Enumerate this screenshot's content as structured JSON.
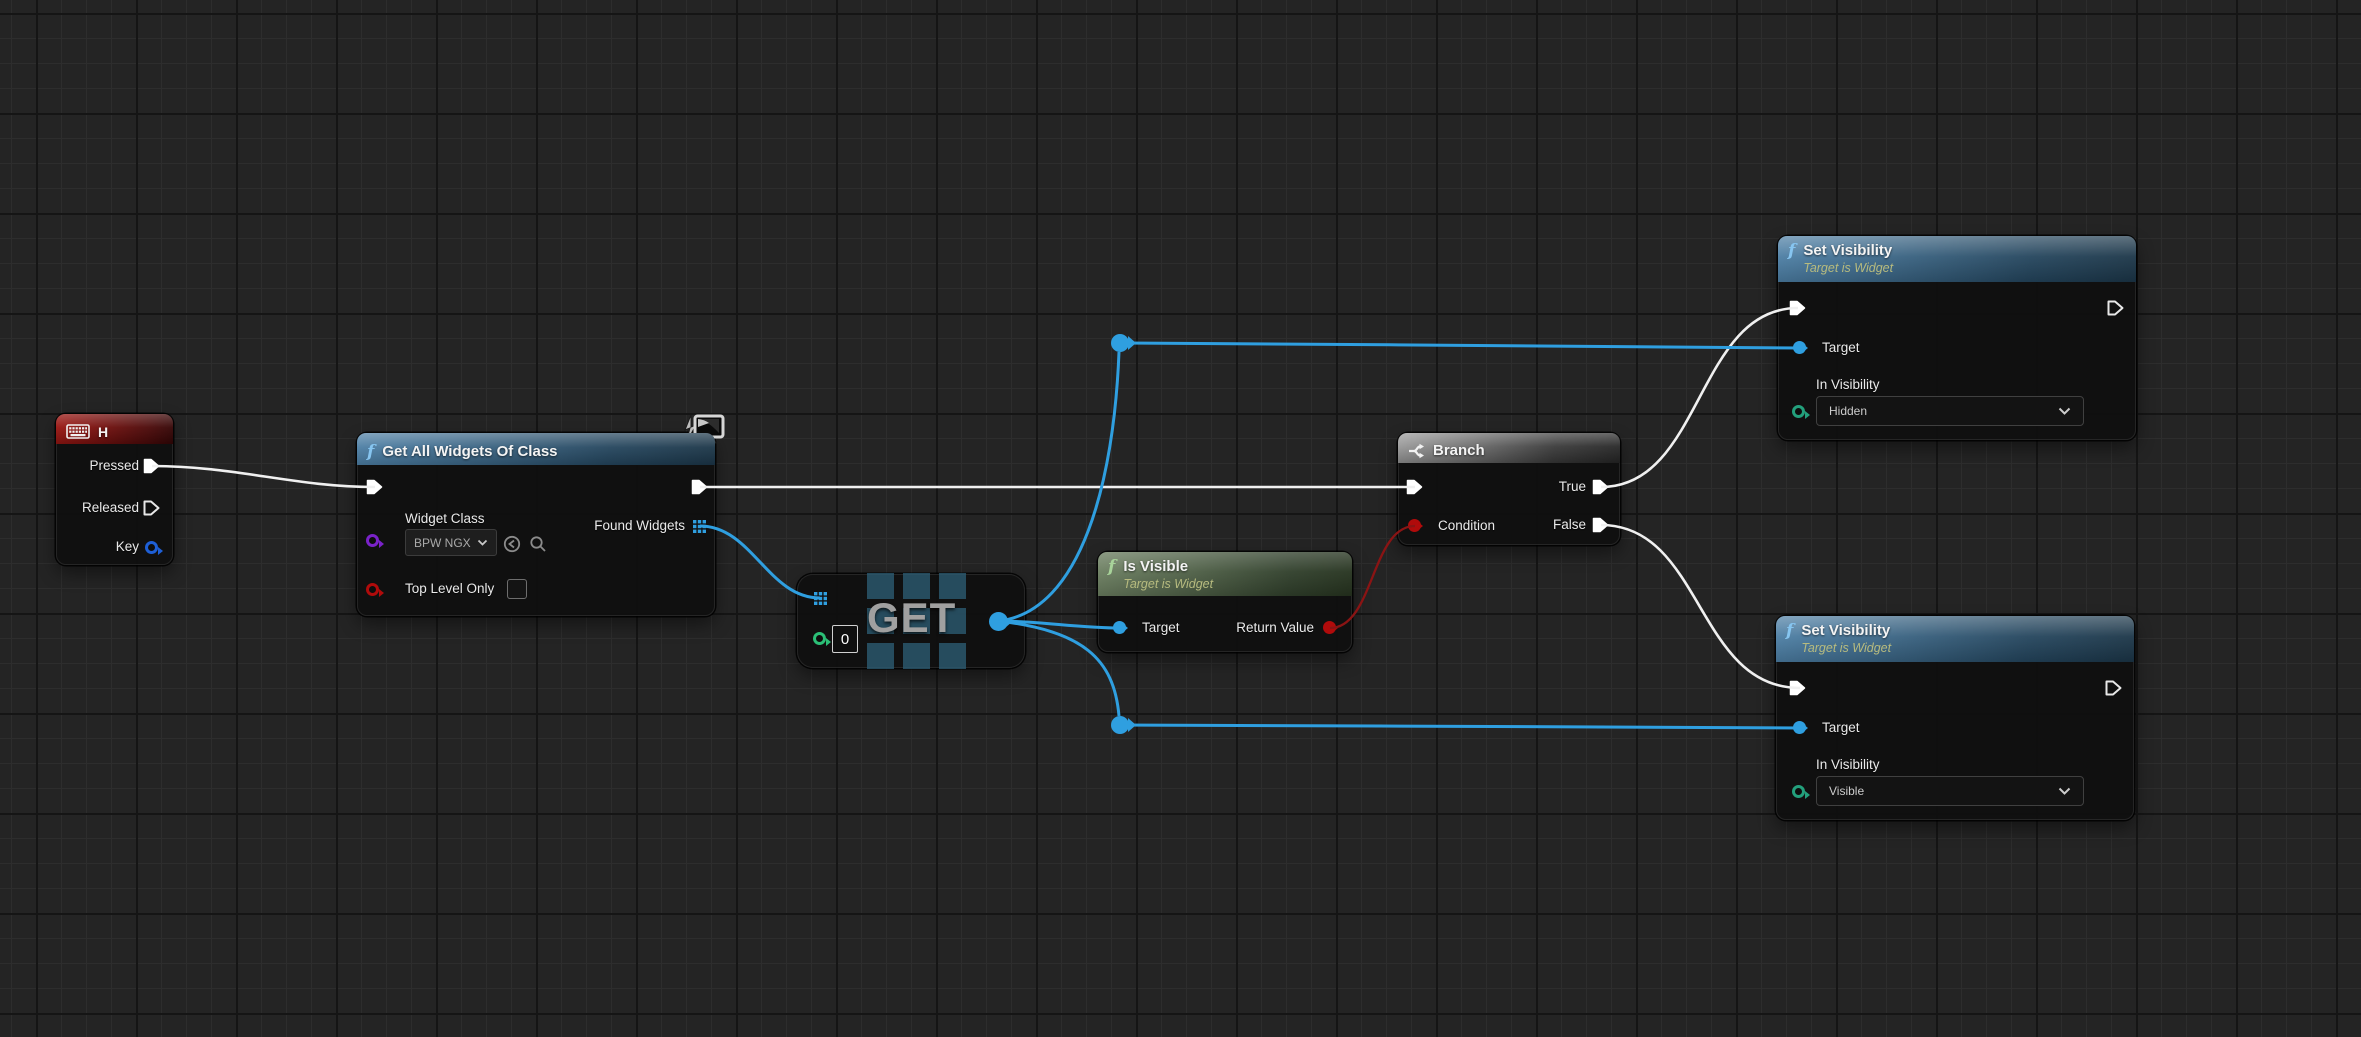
{
  "key_event": {
    "title": "H",
    "pins": {
      "pressed": "Pressed",
      "released": "Released",
      "key": "Key"
    }
  },
  "get_all_widgets": {
    "title": "Get All Widgets Of Class",
    "pins": {
      "widget_class": "Widget Class",
      "found_widgets": "Found Widgets",
      "top_level_only": "Top Level Only"
    },
    "widget_class_value": "BPW NGX"
  },
  "array_get": {
    "watermark": "GET",
    "index_value": "0"
  },
  "is_visible": {
    "title": "Is Visible",
    "subtitle": "Target is Widget",
    "pins": {
      "target": "Target",
      "return_value": "Return Value"
    }
  },
  "branch": {
    "title": "Branch",
    "pins": {
      "condition": "Condition",
      "true_out": "True",
      "false_out": "False"
    }
  },
  "set_visibility_top": {
    "title": "Set Visibility",
    "subtitle": "Target is Widget",
    "pins": {
      "target": "Target",
      "in_visibility": "In Visibility"
    },
    "in_visibility_value": "Hidden"
  },
  "set_visibility_bottom": {
    "title": "Set Visibility",
    "subtitle": "Target is Widget",
    "pins": {
      "target": "Target",
      "in_visibility": "In Visibility"
    },
    "in_visibility_value": "Visible"
  },
  "colors": {
    "exec_wire": "#f0f0f0",
    "object_wire": "#2f9fe0",
    "bool_wire": "#8a1414",
    "event_header": "#9c1713",
    "function_header": "#4d7fa5",
    "pure_header": "#6d8062",
    "macro_header": "#9a9a9a"
  }
}
